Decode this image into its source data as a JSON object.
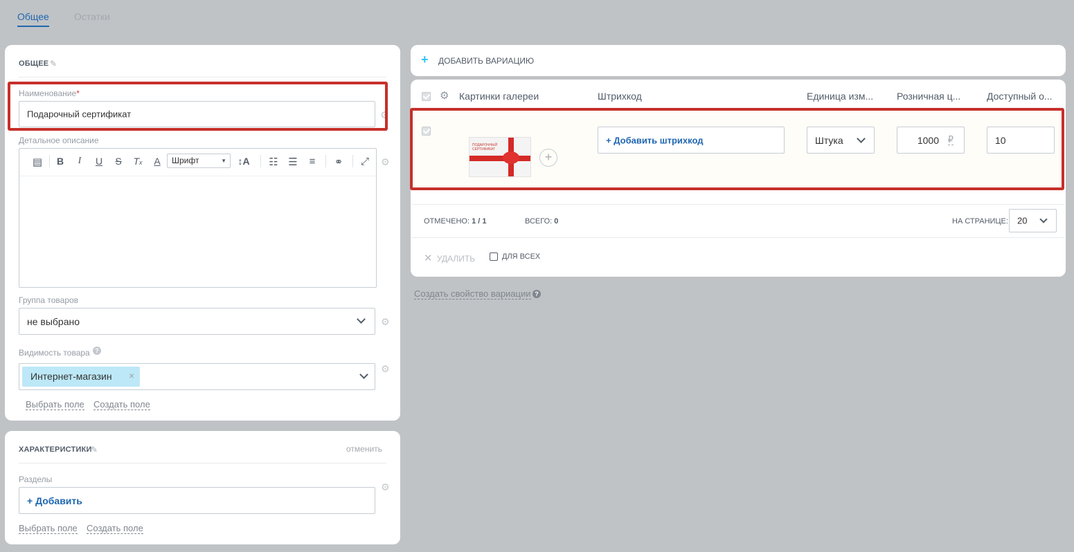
{
  "tabs": [
    {
      "label": "Общее",
      "active": true
    },
    {
      "label": "Остатки",
      "active": false
    }
  ],
  "general": {
    "title": "ОБЩЕЕ",
    "name_label": "Наименование",
    "required_mark": "*",
    "name_value": "Подарочный сертификат",
    "description_label": "Детальное описание",
    "font_select": "Шрифт",
    "group_label": "Группа товаров",
    "group_value": "не выбрано",
    "visibility_label": "Видимость товара",
    "visibility_tag": "Интернет-магазин",
    "tag_remove": "×",
    "select_field": "Выбрать поле",
    "create_field": "Создать поле"
  },
  "characteristics": {
    "title": "ХАРАКТЕРИСТИКИ",
    "cancel": "отменить",
    "sections_label": "Разделы",
    "add_label": "+ Добавить",
    "select_field": "Выбрать поле",
    "create_field": "Создать поле"
  },
  "variations": {
    "add_variation": "ДОБАВИТЬ ВАРИАЦИЮ",
    "columns": [
      "Картинки галереи",
      "Штрихкод",
      "Единица изм...",
      "Розничная ц...",
      "Доступный о..."
    ],
    "row": {
      "image_caption": "ПОДАРОЧНЫЙ СЕРТИФИКАТ",
      "add_barcode": "+ Добавить штрихкод",
      "unit": "Штука",
      "price": "1000",
      "currency": "₽",
      "available": "10"
    },
    "footer": {
      "selected_label": "ОТМЕЧЕНО:",
      "selected_value": "1 / 1",
      "total_label": "ВСЕГО:",
      "total_value": "0",
      "per_page_label": "НА СТРАНИЦЕ:",
      "per_page_value": "20"
    },
    "actions": {
      "delete": "УДАЛИТЬ",
      "for_all": "ДЛЯ ВСЕХ"
    },
    "create_property": "Создать свойство вариации"
  },
  "colors": {
    "accent": "#2067b0",
    "highlight_frame": "#c6302a",
    "tag_bg": "#bde8f7",
    "row_bg": "#fffdf8"
  }
}
